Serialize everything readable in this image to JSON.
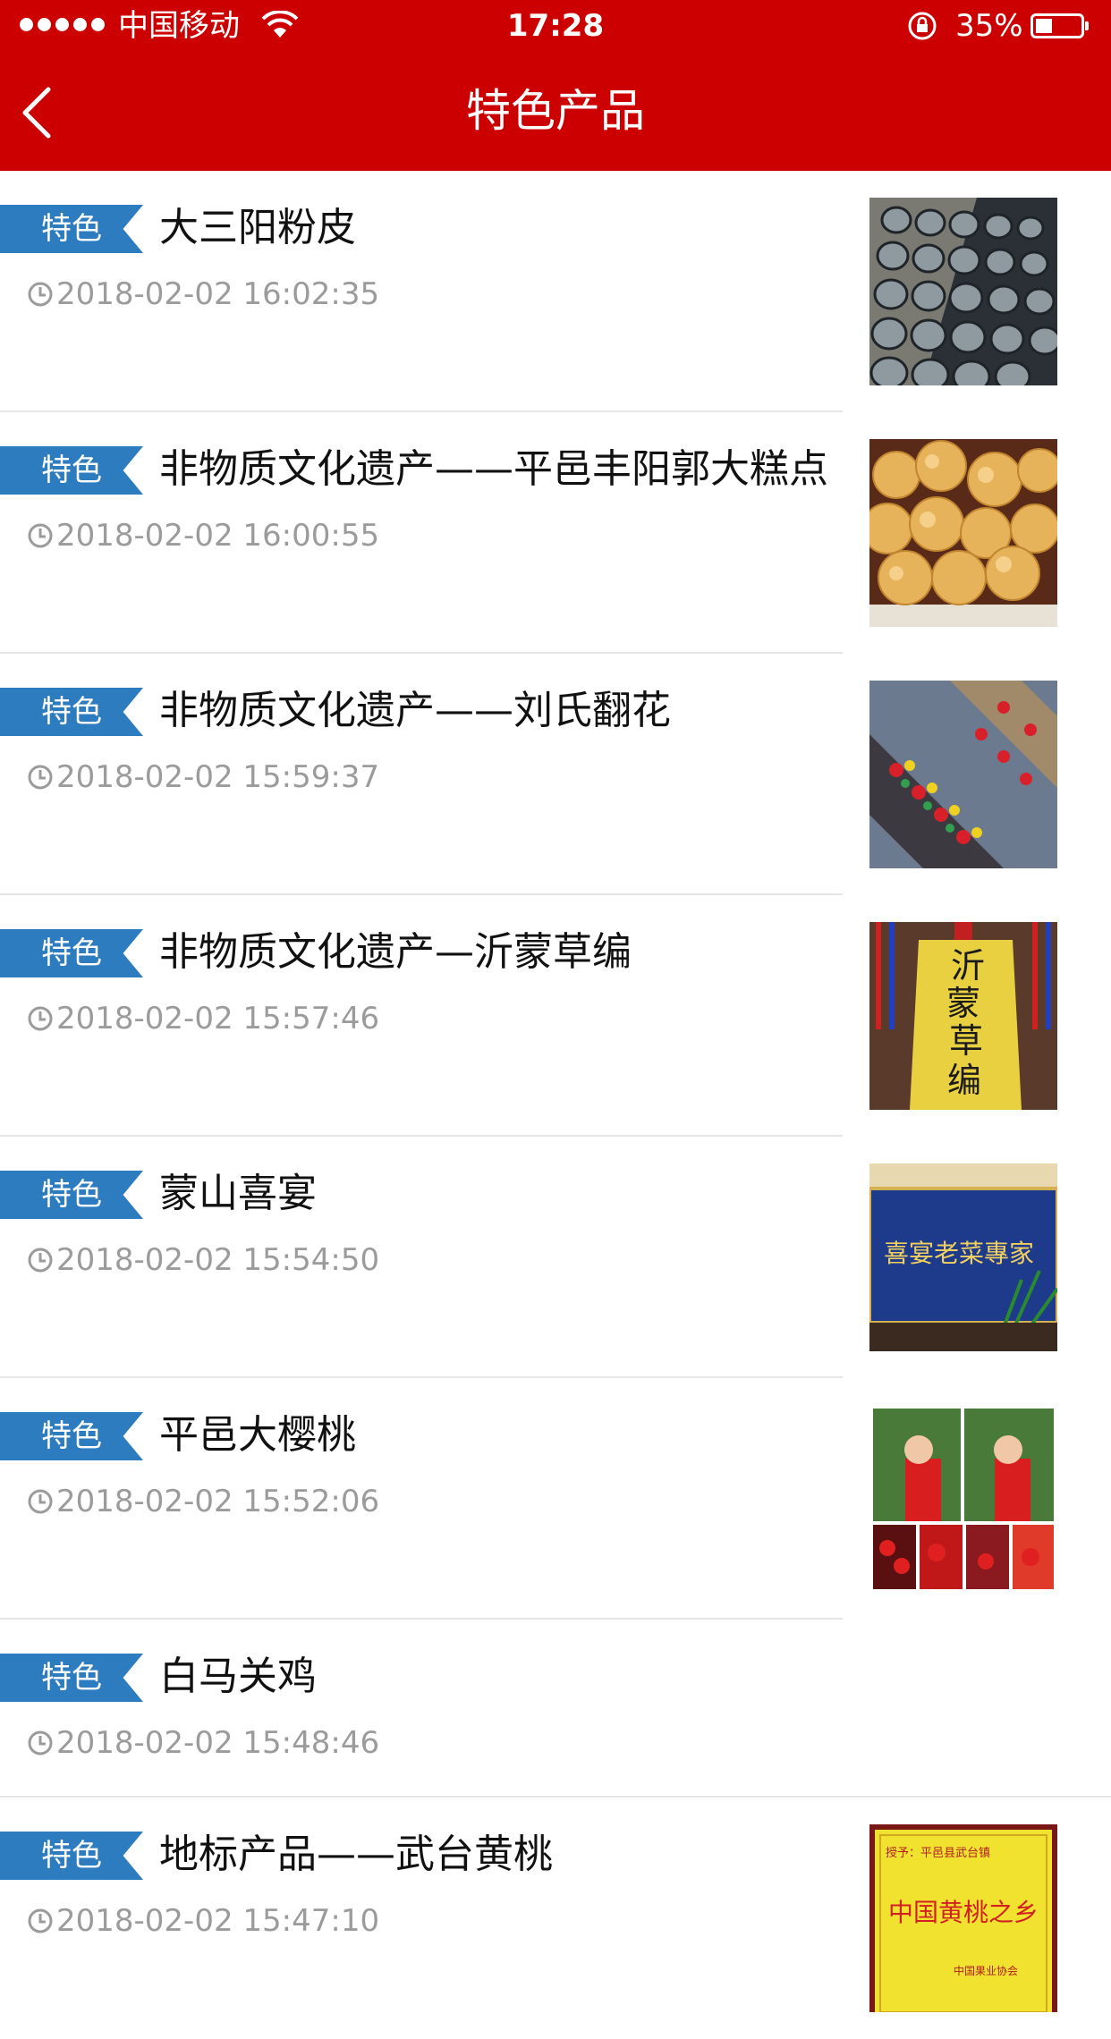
{
  "status_bar": {
    "carrier": "中国移动",
    "time": "17:28",
    "battery": "35%"
  },
  "header": {
    "title": "特色产品"
  },
  "items": [
    {
      "tag": "特色",
      "title": "大三阳粉皮",
      "date": "2018-02-02 16:02:35",
      "image": "rice-noodle-sheets"
    },
    {
      "tag": "特色",
      "title": "非物质文化遗产——平邑丰阳郭大糕点",
      "date": "2018-02-02 16:00:55",
      "image": "pastries"
    },
    {
      "tag": "特色",
      "title": "非物质文化遗产——刘氏翻花",
      "date": "2018-02-02 15:59:37",
      "image": "paper-flowers"
    },
    {
      "tag": "特色",
      "title": "非物质文化遗产—沂蒙草编",
      "date": "2018-02-02 15:57:46",
      "image": "straw-weaving",
      "image_text": [
        "沂",
        "蒙",
        "草",
        "编"
      ]
    },
    {
      "tag": "特色",
      "title": "蒙山喜宴",
      "date": "2018-02-02 15:54:50",
      "image": "wedding-banquet",
      "image_text": "喜宴老菜專家"
    },
    {
      "tag": "特色",
      "title": "平邑大樱桃",
      "date": "2018-02-02 15:52:06",
      "image": "cherries"
    },
    {
      "tag": "特色",
      "title": "白马关鸡",
      "date": "2018-02-02 15:48:46"
    },
    {
      "tag": "特色",
      "title": "地标产品——武台黄桃",
      "date": "2018-02-02 15:47:10",
      "image": "certificate",
      "image_text": [
        "授予：平邑县武台镇",
        "中国黄桃之乡",
        "中国果业协会"
      ]
    }
  ],
  "colors": {
    "header_bg": "#cc0000",
    "tag_bg": "#2e7cc0",
    "date_text": "#9b9b9b"
  }
}
